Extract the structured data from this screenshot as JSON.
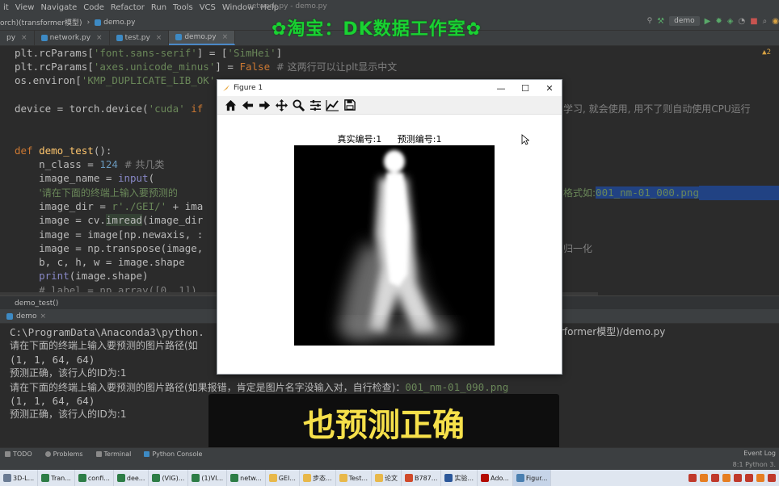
{
  "menu": [
    "it",
    "View",
    "Navigate",
    "Code",
    "Refactor",
    "Run",
    "Tools",
    "VCS",
    "Window",
    "Help"
  ],
  "window_title": "network.py - demo.py",
  "watermark": "✿淘宝：DK数据工作室✿",
  "nav": {
    "crumb_project": "orch)(transformer模型)",
    "crumb_file": "demo.py",
    "run_config": "demo"
  },
  "tabs": [
    {
      "label": "py"
    },
    {
      "label": "network.py"
    },
    {
      "label": "test.py"
    },
    {
      "label": "demo.py"
    }
  ],
  "editor": {
    "warning_count": "▲2",
    "lines": {
      "l1a": "plt.rcParams[",
      "l1b": "'font.sans-serif'",
      "l1c": "] = [",
      "l1d": "'SimHei'",
      "l1e": "]",
      "l2a": "plt.rcParams[",
      "l2b": "'axes.unicode_minus'",
      "l2c": "] = ",
      "l2d": "False",
      "l2e": "  # 这两行可以让plt显示中文",
      "l3a": "os.environ[",
      "l3b": "'KMP_DUPLICATE_LIB_OK'",
      "l4a": "device = torch.device(",
      "l4b": "'cuda'",
      "l4c": " if",
      "l4_right": "学习, 就会使用, 用不了则自动使用CPU运行",
      "l5a": "def",
      "l5b": " demo_test",
      "l5c": "():",
      "l6a": "    n_class = ",
      "l6b": "124",
      "l6c": "  # 共几类",
      "l7a": "    image_name = ",
      "l7b": "input",
      "l7c": "(",
      "l8a": "        '请在下面的终端上输入要预测的",
      "l8_right_a": "格式如:",
      "l8_right_b": "001_nm-01_000.png",
      "l9a": "    image_dir = ",
      "l9b": "r'./GEI/'",
      "l9c": " + ima",
      "l10a": "    image = cv.",
      "l10b": "imread",
      "l10c": "(image_dir",
      "l11a": "    image = image[np.newaxis, :",
      "l12a": "    image = np.transpose(image,",
      "l12_right": "归一化",
      "l13a": "    b, c, h, w = image.shape",
      "l14a": "    ",
      "l14b": "print",
      "l14c": "(image.shape)",
      "l15a": "    # label = np.array([0, 1])"
    }
  },
  "status_crumb": "demo_test()",
  "run_tab": "demo",
  "console": {
    "c1a": "C:\\ProgramData\\Anaconda3\\python.",
    "c1b": "rformer模型)/demo.py",
    "c2": "请在下面的终端上输入要预测的图片路径(如",
    "c3": "(1, 1, 64, 64)",
    "c4": "预测正确，该行人的ID为:1",
    "c5a": "请在下面的终端上输入要预测的图片路径(如果报错，肯定是图片名字没输入对，自行检查)：",
    "c5b": "001_nm-01_090.png",
    "c6": "(1, 1, 64, 64)",
    "c7": "预测正确，该行人的ID为:1"
  },
  "subtitle": "也预测正确",
  "tool_windows": [
    "TODO",
    "Problems",
    "Terminal",
    "Python Console"
  ],
  "tool_right": "Event Log",
  "status_right": "8:1  Python 3.",
  "taskbar": [
    {
      "label": "3D-L..."
    },
    {
      "label": "Tran..."
    },
    {
      "label": "confi..."
    },
    {
      "label": "dee..."
    },
    {
      "label": "(VIG)..."
    },
    {
      "label": "(1)VI..."
    },
    {
      "label": "netw..."
    },
    {
      "label": "GEI..."
    },
    {
      "label": "步态..."
    },
    {
      "label": "Test..."
    },
    {
      "label": "论文"
    },
    {
      "label": "B787..."
    },
    {
      "label": "实验..."
    },
    {
      "label": "Ado..."
    },
    {
      "label": "Figur..."
    }
  ],
  "figure": {
    "title": "Figure 1",
    "plot_title_true": "真实编号:1",
    "plot_title_pred": "预测编号:1",
    "toolbar": [
      "home-icon",
      "back-icon",
      "forward-icon",
      "pan-icon",
      "zoom-icon",
      "configure-icon",
      "edit-axes-icon",
      "save-icon"
    ]
  }
}
